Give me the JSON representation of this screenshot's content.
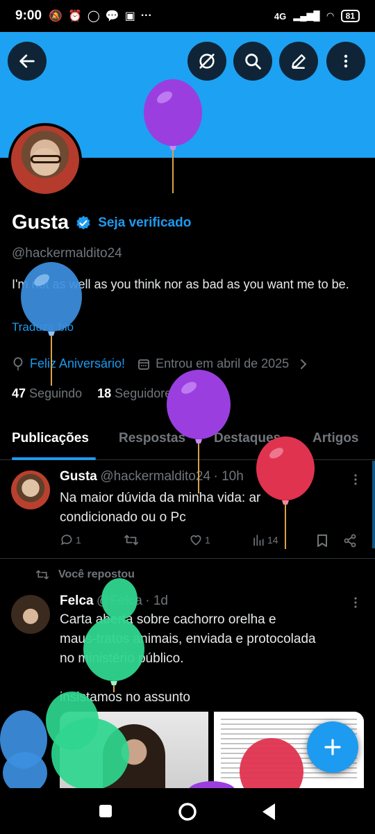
{
  "status": {
    "time": "9:00",
    "network": "4G",
    "battery": "81"
  },
  "profile": {
    "name": "Gusta",
    "verify_link": "Seja verificado",
    "handle": "@hackermaldito24",
    "bio": "I'm not as well as you think nor as bad as you want me to be.",
    "translate_bio": "Traduzir bio",
    "birthday": "Feliz Aniversário!",
    "joined": "Entrou em abril de 2025",
    "following_count": "47",
    "following_label": "Seguindo",
    "followers_count": "18",
    "followers_label": "Seguidores"
  },
  "tabs": [
    "Publicações",
    "Respostas",
    "Destaques",
    "Artigos"
  ],
  "posts": [
    {
      "author": "Gusta",
      "handle": "@hackermaldito24",
      "time": "· 10h",
      "text_line1": "Na maior dúvida da minha vida: ar",
      "text_line2": "condicionado ou o Pc",
      "replies": "1",
      "likes": "1",
      "views": "14"
    },
    {
      "repost_label": "Você repostou",
      "author": "Felca",
      "handle": "@Felca",
      "time": "· 1d",
      "text_line1": "Carta aberta sobre cachorro orelha e",
      "text_line2": "maus-tratos animais, enviada e protocolada",
      "text_line3": "no ministério público.",
      "text_line4": "insistamos no assunto"
    }
  ],
  "colors": {
    "accent": "#1d9bf0",
    "banner": "#1da1f2",
    "background": "#000000",
    "muted": "#71767b",
    "balloon_purple": "#9b3ee0",
    "balloon_blue": "#3d8fe0",
    "balloon_red": "#e0334f",
    "balloon_green": "#2fd68e"
  }
}
